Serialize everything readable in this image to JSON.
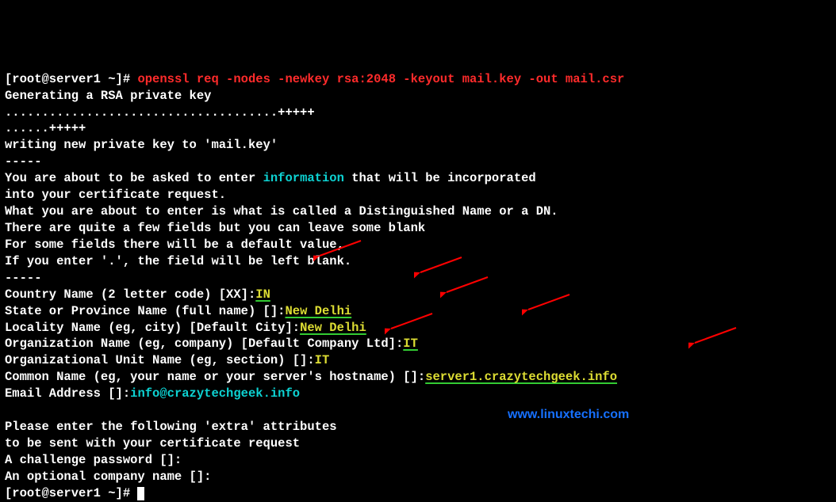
{
  "prompt": {
    "prefix": "[root@server1 ~]# ",
    "command": "openssl req -nodes -newkey rsa:2048 -keyout mail.key -out mail.csr"
  },
  "finalPrompt": "[root@server1 ~]# ",
  "lines": {
    "gen": "Generating a RSA private key",
    "dots1": ".....................................+++++",
    "dots2": "......+++++",
    "write": "writing new private key to 'mail.key'",
    "dash1": "-----",
    "msg1a": "You are about to be asked to enter ",
    "msg1b_hl": "information",
    "msg1c": " that will be incorporated",
    "msg2": "into your certificate request.",
    "msg3": "What you are about to enter is what is called a Distinguished Name or a DN.",
    "msg4": "There are quite a few fields but you can leave some blank",
    "msg5": "For some fields there will be a default value,",
    "msg6": "If you enter '.', the field will be left blank.",
    "dash2": "-----",
    "q_country": "Country Name (2 letter code) [XX]:",
    "a_country": "IN",
    "q_state": "State or Province Name (full name) []:",
    "a_state": "New Delhi",
    "q_locality": "Locality Name (eg, city) [Default City]:",
    "a_locality": "New Delhi",
    "q_org": "Organization Name (eg, company) [Default Company Ltd]:",
    "a_org": "IT",
    "q_ou": "Organizational Unit Name (eg, section) []:",
    "a_ou": "IT",
    "q_cn": "Common Name (eg, your name or your server's hostname) []:",
    "a_cn": "server1.crazytechgeek.info",
    "q_email": "Email Address []:",
    "a_email": "info@crazytechgeek.info",
    "extra1": "Please enter the following 'extra' attributes",
    "extra2": "to be sent with your certificate request",
    "q_chal": "A challenge password []:",
    "q_optco": "An optional company name []:"
  },
  "watermark": "www.linuxtechi.com",
  "chart_data": {
    "type": "terminal-session",
    "command": "openssl req -nodes -newkey rsa:2048 -keyout mail.key -out mail.csr",
    "csr_fields": {
      "Country Name": "IN",
      "State or Province Name": "New Delhi",
      "Locality Name": "New Delhi",
      "Organization Name": "IT",
      "Organizational Unit Name": "IT",
      "Common Name": "server1.crazytechgeek.info",
      "Email Address": "info@crazytechgeek.info",
      "A challenge password": "",
      "An optional company name": ""
    }
  }
}
